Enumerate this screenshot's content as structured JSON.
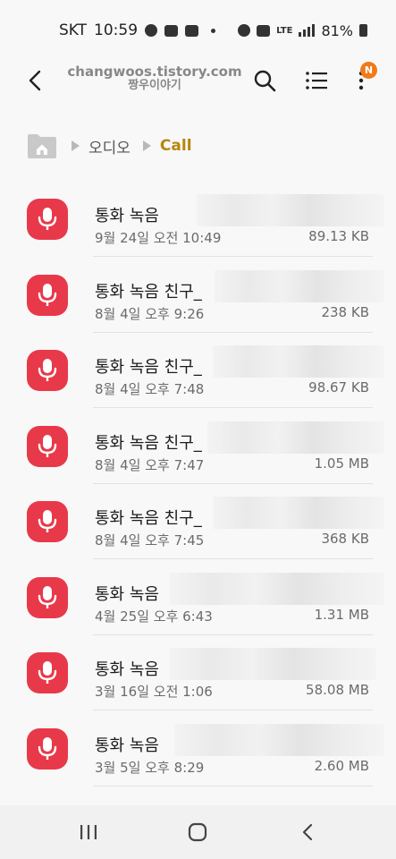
{
  "status_bar": {
    "carrier": "SKT",
    "time": "10:59",
    "network": "LTE",
    "battery": "81%"
  },
  "app_bar": {
    "watermark_line1": "changwoos.tistory.com",
    "watermark_line2": "짱우이야기",
    "notification_badge": "N",
    "badge_color": "#f07a1a"
  },
  "breadcrumb": {
    "items": [
      "오디오"
    ],
    "current": "Call",
    "current_color": "#b6860c"
  },
  "files": [
    {
      "name": "통화 녹음 ",
      "date": "9월 24일 오전 10:49",
      "size": "89.13 KB"
    },
    {
      "name": "통화 녹음 친구_",
      "date": "8월 4일 오후 9:26",
      "size": "238 KB"
    },
    {
      "name": "통화 녹음 친구_",
      "date": "8월 4일 오후 7:48",
      "size": "98.67 KB"
    },
    {
      "name": "통화 녹음 친구_",
      "date": "8월 4일 오후 7:47",
      "size": "1.05 MB"
    },
    {
      "name": "통화 녹음 친구_",
      "date": "8월 4일 오후 7:45",
      "size": "368 KB"
    },
    {
      "name": "통화 녹음 ",
      "date": "4월 25일 오후 6:43",
      "size": "1.31 MB"
    },
    {
      "name": "통화 녹음 ",
      "date": "3월 16일 오전 1:06",
      "size": "58.08 MB"
    },
    {
      "name": "통화 녹음 ",
      "date": "3월 5일 오후 8:29",
      "size": "2.60 MB"
    }
  ],
  "file_icon": {
    "name": "microphone-icon",
    "color": "#e8394a"
  },
  "nav_bar": {
    "icons": [
      "recent-apps-icon",
      "home-icon",
      "back-icon"
    ]
  }
}
